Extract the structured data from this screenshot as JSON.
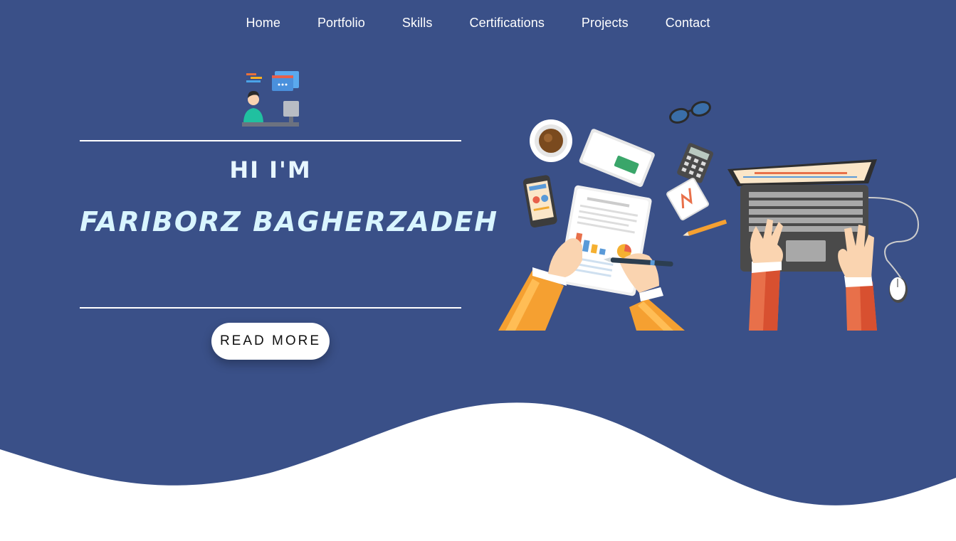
{
  "nav": {
    "items": [
      "Home",
      "Portfolio",
      "Skills",
      "Certifications",
      "Projects",
      "Contact"
    ]
  },
  "hero": {
    "greeting": "HI I'M",
    "name": "FARIBORZ BAGHERZADEH",
    "cta_label": "READ MORE",
    "avatar_icon": "developer-at-desk-icon",
    "illustration": "workspace-desk-illustration"
  },
  "colors": {
    "background": "#3a5088",
    "wave": "#ffffff",
    "heading_text": "#d9f5ff",
    "button_bg": "#ffffff"
  }
}
